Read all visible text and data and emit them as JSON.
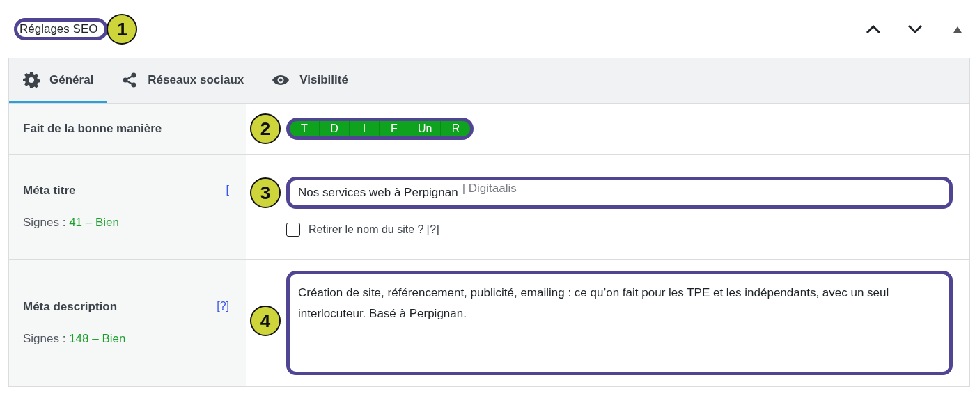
{
  "title": "Réglages SEO",
  "callouts": [
    "1",
    "2",
    "3",
    "4"
  ],
  "tabs": [
    {
      "label": "Général",
      "kind": "gear",
      "selected": true
    },
    {
      "label": "Réseaux sociaux",
      "kind": "share",
      "selected": false
    },
    {
      "label": "Visibilité",
      "kind": "eye",
      "selected": false
    }
  ],
  "score": {
    "label": "Fait de la bonne manière",
    "segments": [
      "T",
      "D",
      "I",
      "F",
      "Un",
      "R"
    ]
  },
  "meta_title": {
    "label": "Méta titre",
    "help": "[",
    "count_label": "Signes : ",
    "count": "41 – Bien",
    "value": "Nos services web à Perpignan",
    "suffix": "| Digitaalis",
    "checkbox": {
      "label": "Retirer le nom du site ? [?]",
      "checked": false
    }
  },
  "meta_description": {
    "label": "Méta description",
    "help": "[?]",
    "count_label": "Signes : ",
    "count": "148 – Bien",
    "value": "Création de site, référencement, publicité, emailing : ce qu’on fait pour les TPE et les indépendants, avec un seul interlocuteur. Basé à Perpignan."
  }
}
